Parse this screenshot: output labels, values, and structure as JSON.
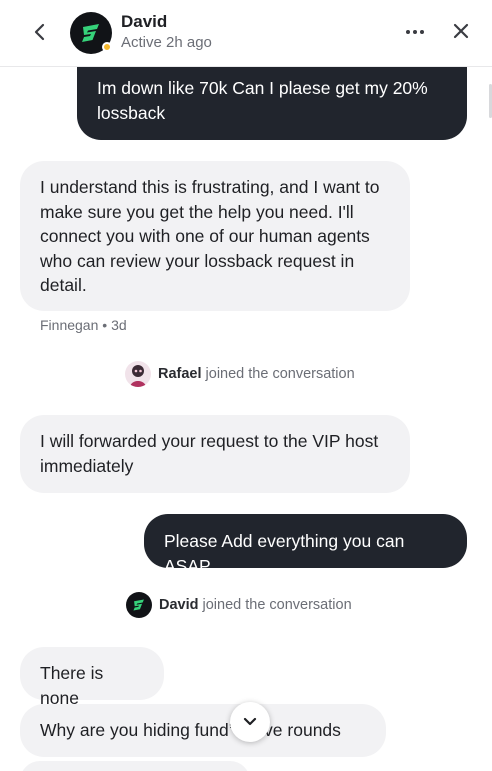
{
  "header": {
    "agent_name": "David",
    "agent_status": "Active 2h ago",
    "status_color": "#f5b82e",
    "icons": [
      "chevron-left-icon",
      "brand-logo-icon",
      "more-horizontal-icon",
      "close-icon"
    ]
  },
  "messages": [
    {
      "from": "user",
      "text": "Im down like 70k Can I plaese get my 20% lossback"
    },
    {
      "from": "agent",
      "text": "I understand this is frustrating, and I want to make sure you get the help you need. I'll connect you with one of our human agents who can review your lossback request in detail."
    },
    {
      "from": "agent",
      "text": "I will forwarded your request to the VIP host immediately"
    },
    {
      "from": "user",
      "text": "Please Add everything you can ASAP"
    },
    {
      "from": "agent",
      "text": "There is none"
    },
    {
      "from": "agent",
      "text": "Why are you hiding fund’   active rounds"
    }
  ],
  "meta": {
    "sender": "Finnegan",
    "separator": "•",
    "time": "3d"
  },
  "events": [
    {
      "name": "Rafael",
      "text": "joined the conversation"
    },
    {
      "name": "David",
      "text": "joined the conversation"
    }
  ],
  "colors": {
    "outgoing_bubble": "#21252d",
    "incoming_bubble": "#f2f2f4",
    "brand_green": "#36d27a"
  }
}
